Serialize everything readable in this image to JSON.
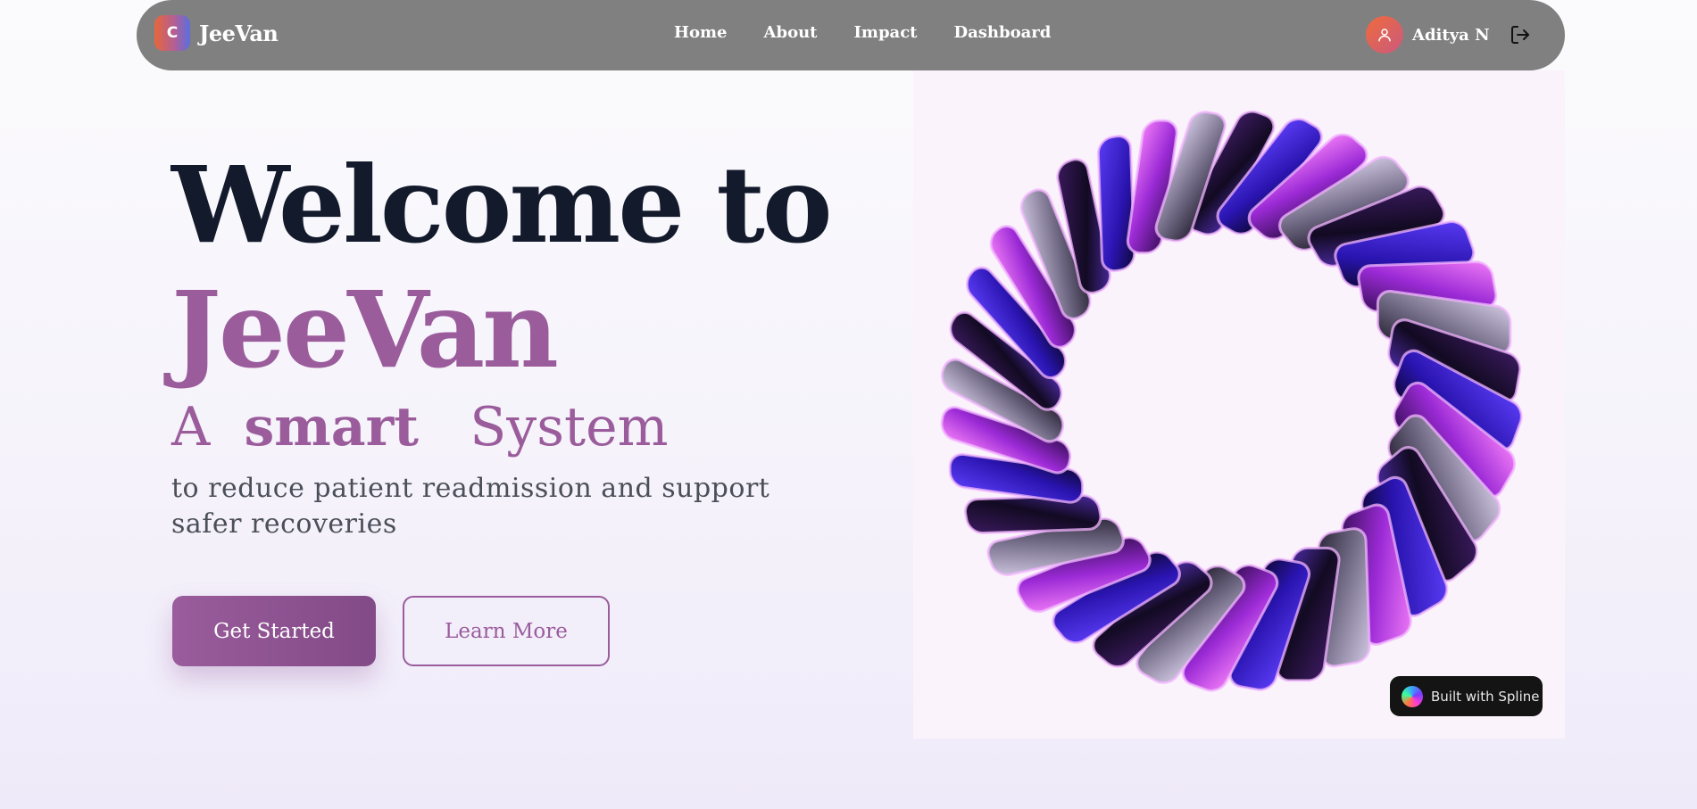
{
  "nav": {
    "logo_letter": "C",
    "brand": "JeeVan",
    "links": [
      "Home",
      "About",
      "Impact",
      "Dashboard"
    ],
    "user_name": "Aditya N"
  },
  "hero": {
    "title_line1": "Welcome to",
    "title_line2": "JeeVan",
    "tagline_a": "A",
    "tagline_smart": "smart",
    "tagline_system": "System",
    "subtitle": "to reduce patient readmission and support safer recoveries",
    "primary_button": "Get Started",
    "secondary_button": "Learn More"
  },
  "spline": {
    "badge": "Built with Spline"
  },
  "colors": {
    "accent": "#9b5c9c",
    "navbar": "#808080",
    "heading": "#121a2b",
    "ring_dark": "#1a0f2e",
    "ring_blue": "#3b1fd6",
    "ring_violet": "#7b3cf0",
    "ring_magenta": "#d23ee8"
  },
  "icons": [
    "user-icon",
    "logout-icon",
    "spline-logo-icon"
  ]
}
